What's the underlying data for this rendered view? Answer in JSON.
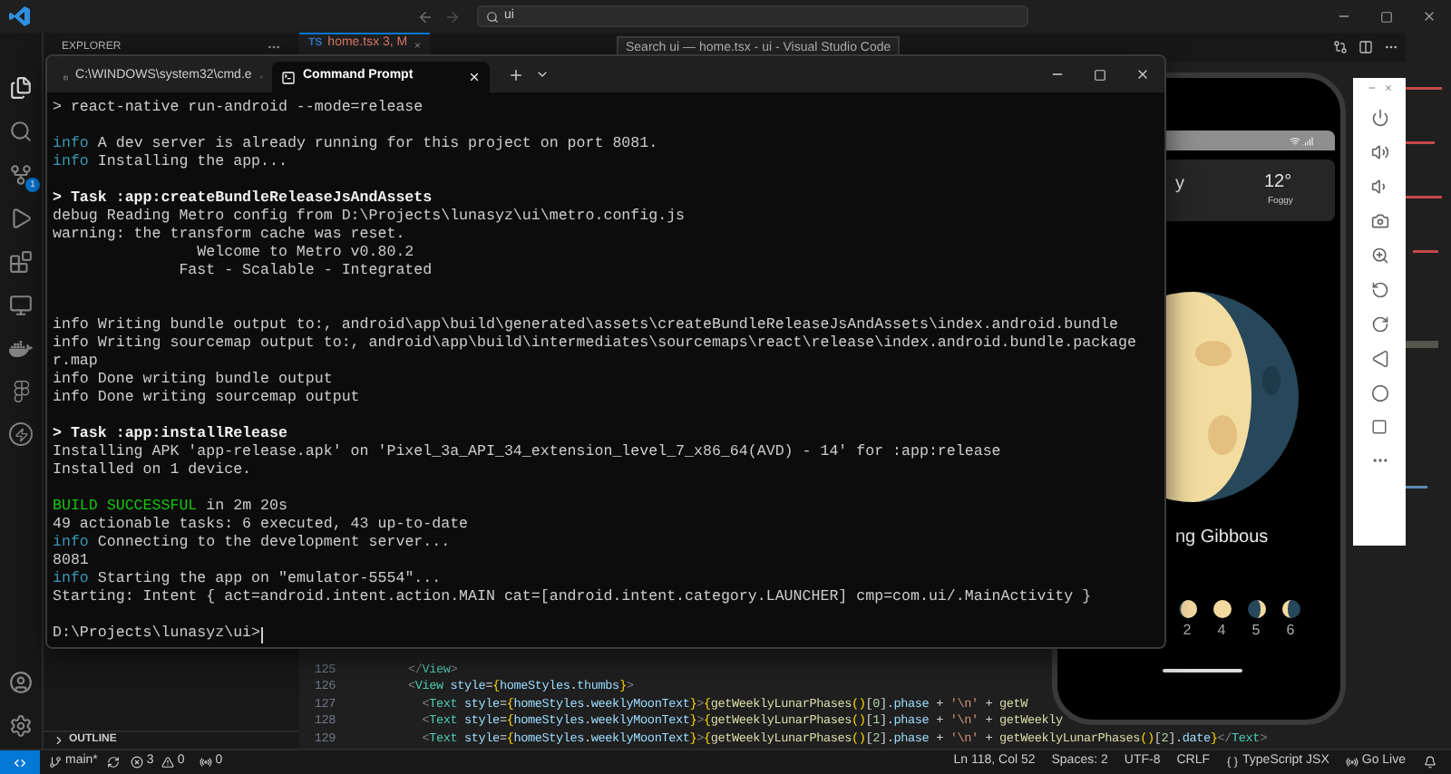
{
  "title_bar": {
    "search": {
      "value": "ui"
    }
  },
  "activity_bar": {
    "scm_badge": "1"
  },
  "sidebar": {
    "title": "EXPLORER",
    "outline": {
      "title": "OUTLINE",
      "expanded": false
    }
  },
  "editor": {
    "tabs": [
      {
        "lang": "TS",
        "label": "home.tsx 3, M",
        "selected": true
      }
    ],
    "tooltip": "Search ui — home.tsx - ui - Visual Studio Code",
    "lines": [
      {
        "number": "125",
        "tokens": [
          {
            "kind": "punct",
            "text": "</"
          },
          {
            "kind": "tag",
            "text": "View"
          },
          {
            "kind": "punct",
            "text": ">"
          }
        ]
      },
      {
        "number": "126",
        "tokens": [
          {
            "kind": "punct",
            "text": "<"
          },
          {
            "kind": "tag",
            "text": "View"
          },
          {
            "kind": "attr",
            "text": " style"
          },
          {
            "kind": "plain",
            "text": "="
          },
          {
            "kind": "brace",
            "text": "{"
          },
          {
            "kind": "var",
            "text": "homeStyles"
          },
          {
            "kind": "plain",
            "text": "."
          },
          {
            "kind": "var",
            "text": "thumbs"
          },
          {
            "kind": "brace",
            "text": "}"
          },
          {
            "kind": "punct",
            "text": ">"
          }
        ]
      },
      {
        "number": "127",
        "tokens": [
          {
            "kind": "punct",
            "text": "  <"
          },
          {
            "kind": "tag",
            "text": "Text"
          },
          {
            "kind": "attr",
            "text": " style"
          },
          {
            "kind": "plain",
            "text": "="
          },
          {
            "kind": "brace",
            "text": "{"
          },
          {
            "kind": "var",
            "text": "homeStyles"
          },
          {
            "kind": "plain",
            "text": "."
          },
          {
            "kind": "var",
            "text": "weeklyMoonText"
          },
          {
            "kind": "brace",
            "text": "}"
          },
          {
            "kind": "punct",
            "text": ">"
          },
          {
            "kind": "brace",
            "text": "{"
          },
          {
            "kind": "func",
            "text": "getWeeklyLunarPhases"
          },
          {
            "kind": "brace",
            "text": "()"
          },
          {
            "kind": "plain",
            "text": "["
          },
          {
            "kind": "num",
            "text": "0"
          },
          {
            "kind": "plain",
            "text": "]."
          },
          {
            "kind": "var",
            "text": "phase"
          },
          {
            "kind": "plain",
            "text": " + "
          },
          {
            "kind": "string",
            "text": "'\\n'"
          },
          {
            "kind": "plain",
            "text": " + "
          },
          {
            "kind": "func",
            "text": "getW"
          }
        ]
      },
      {
        "number": "128",
        "tokens": [
          {
            "kind": "punct",
            "text": "  <"
          },
          {
            "kind": "tag",
            "text": "Text"
          },
          {
            "kind": "attr",
            "text": " style"
          },
          {
            "kind": "plain",
            "text": "="
          },
          {
            "kind": "brace",
            "text": "{"
          },
          {
            "kind": "var",
            "text": "homeStyles"
          },
          {
            "kind": "plain",
            "text": "."
          },
          {
            "kind": "var",
            "text": "weeklyMoonText"
          },
          {
            "kind": "brace",
            "text": "}"
          },
          {
            "kind": "punct",
            "text": ">"
          },
          {
            "kind": "brace",
            "text": "{"
          },
          {
            "kind": "func",
            "text": "getWeeklyLunarPhases"
          },
          {
            "kind": "brace",
            "text": "()"
          },
          {
            "kind": "plain",
            "text": "["
          },
          {
            "kind": "num",
            "text": "1"
          },
          {
            "kind": "plain",
            "text": "]."
          },
          {
            "kind": "var",
            "text": "phase"
          },
          {
            "kind": "plain",
            "text": " + "
          },
          {
            "kind": "string",
            "text": "'\\n'"
          },
          {
            "kind": "plain",
            "text": " + "
          },
          {
            "kind": "func",
            "text": "getWeekly"
          }
        ]
      },
      {
        "number": "129",
        "tokens": [
          {
            "kind": "punct",
            "text": "  <"
          },
          {
            "kind": "tag",
            "text": "Text"
          },
          {
            "kind": "attr",
            "text": " style"
          },
          {
            "kind": "plain",
            "text": "="
          },
          {
            "kind": "brace",
            "text": "{"
          },
          {
            "kind": "var",
            "text": "homeStyles"
          },
          {
            "kind": "plain",
            "text": "."
          },
          {
            "kind": "var",
            "text": "weeklyMoonText"
          },
          {
            "kind": "brace",
            "text": "}"
          },
          {
            "kind": "punct",
            "text": ">"
          },
          {
            "kind": "brace",
            "text": "{"
          },
          {
            "kind": "func",
            "text": "getWeeklyLunarPhases"
          },
          {
            "kind": "brace",
            "text": "()"
          },
          {
            "kind": "plain",
            "text": "["
          },
          {
            "kind": "num",
            "text": "2"
          },
          {
            "kind": "plain",
            "text": "]."
          },
          {
            "kind": "var",
            "text": "phase"
          },
          {
            "kind": "plain",
            "text": " + "
          },
          {
            "kind": "string",
            "text": "'\\n'"
          },
          {
            "kind": "plain",
            "text": " + "
          },
          {
            "kind": "func",
            "text": "getWeeklyLunarPhases"
          },
          {
            "kind": "brace",
            "text": "()"
          },
          {
            "kind": "plain",
            "text": "["
          },
          {
            "kind": "num",
            "text": "2"
          },
          {
            "kind": "plain",
            "text": "]."
          },
          {
            "kind": "var",
            "text": "date"
          },
          {
            "kind": "brace",
            "text": "}"
          },
          {
            "kind": "punct",
            "text": "</"
          },
          {
            "kind": "tag",
            "text": "Text"
          },
          {
            "kind": "punct",
            "text": ">"
          }
        ]
      }
    ]
  },
  "terminal": {
    "tabs": [
      {
        "title": "C:\\WINDOWS\\system32\\cmd.e",
        "selected": false
      },
      {
        "title": "Command Prompt",
        "selected": true
      }
    ],
    "lines": [
      {
        "kind": "plain",
        "text": "> react-native run-android --mode=release"
      },
      {
        "kind": "blank"
      },
      {
        "kind": "tagged",
        "tag": "info",
        "text": "A dev server is already running for this project on port 8081."
      },
      {
        "kind": "tagged",
        "tag": "info",
        "text": "Installing the app..."
      },
      {
        "kind": "blank"
      },
      {
        "kind": "bright",
        "text": "> Task :app:createBundleReleaseJsAndAssets"
      },
      {
        "kind": "plain",
        "text": "debug Reading Metro config from D:\\Projects\\lunasyz\\ui\\metro.config.js"
      },
      {
        "kind": "plain",
        "text": "warning: the transform cache was reset."
      },
      {
        "kind": "plain",
        "text": "                Welcome to Metro v0.80.2"
      },
      {
        "kind": "plain",
        "text": "              Fast - Scalable - Integrated"
      },
      {
        "kind": "blank"
      },
      {
        "kind": "blank"
      },
      {
        "kind": "plain",
        "text": "info Writing bundle output to:, android\\app\\build\\generated\\assets\\createBundleReleaseJsAndAssets\\index.android.bundle"
      },
      {
        "kind": "plain",
        "text": "info Writing sourcemap output to:, android\\app\\build\\intermediates\\sourcemaps\\react\\release\\index.android.bundle.package"
      },
      {
        "kind": "plain",
        "text": "r.map"
      },
      {
        "kind": "plain",
        "text": "info Done writing bundle output"
      },
      {
        "kind": "plain",
        "text": "info Done writing sourcemap output"
      },
      {
        "kind": "blank"
      },
      {
        "kind": "bright",
        "text": "> Task :app:installRelease"
      },
      {
        "kind": "plain",
        "text": "Installing APK 'app-release.apk' on 'Pixel_3a_API_34_extension_level_7_x86_64(AVD) - 14' for :app:release"
      },
      {
        "kind": "plain",
        "text": "Installed on 1 device."
      },
      {
        "kind": "blank"
      },
      {
        "kind": "success",
        "tag": "BUILD SUCCESSFUL",
        "text": "in 2m 20s"
      },
      {
        "kind": "plain",
        "text": "49 actionable tasks: 6 executed, 43 up-to-date"
      },
      {
        "kind": "tagged",
        "tag": "info",
        "text": "Connecting to the development server..."
      },
      {
        "kind": "plain",
        "text": "8081"
      },
      {
        "kind": "tagged",
        "tag": "info",
        "text": "Starting the app on \"emulator-5554\"..."
      },
      {
        "kind": "plain",
        "text": "Starting: Intent { act=android.intent.action.MAIN cat=[android.intent.category.LAUNCHER] cmp=com.ui/.MainActivity }"
      },
      {
        "kind": "blank"
      },
      {
        "kind": "prompt",
        "text": "D:\\Projects\\lunasyz\\ui>"
      }
    ]
  },
  "emulator": {
    "weather": {
      "title": "y",
      "temperature": "12°",
      "condition": "Foggy"
    },
    "phase_name": "ng Gibbous",
    "thumbs": [
      {
        "label": "2",
        "kind": "bright"
      },
      {
        "label": "4",
        "kind": "full"
      },
      {
        "label": "5",
        "kind": "dark_left"
      },
      {
        "label": "6",
        "kind": "dark_right"
      }
    ]
  },
  "status_bar": {
    "branch": "main*",
    "errors": "3",
    "warnings": "0",
    "ports": "0",
    "position": "Ln 118, Col 52",
    "spaces": "Spaces: 2",
    "encoding": "UTF-8",
    "eol": "CRLF",
    "language": "TypeScript JSX",
    "live": "Go Live"
  }
}
